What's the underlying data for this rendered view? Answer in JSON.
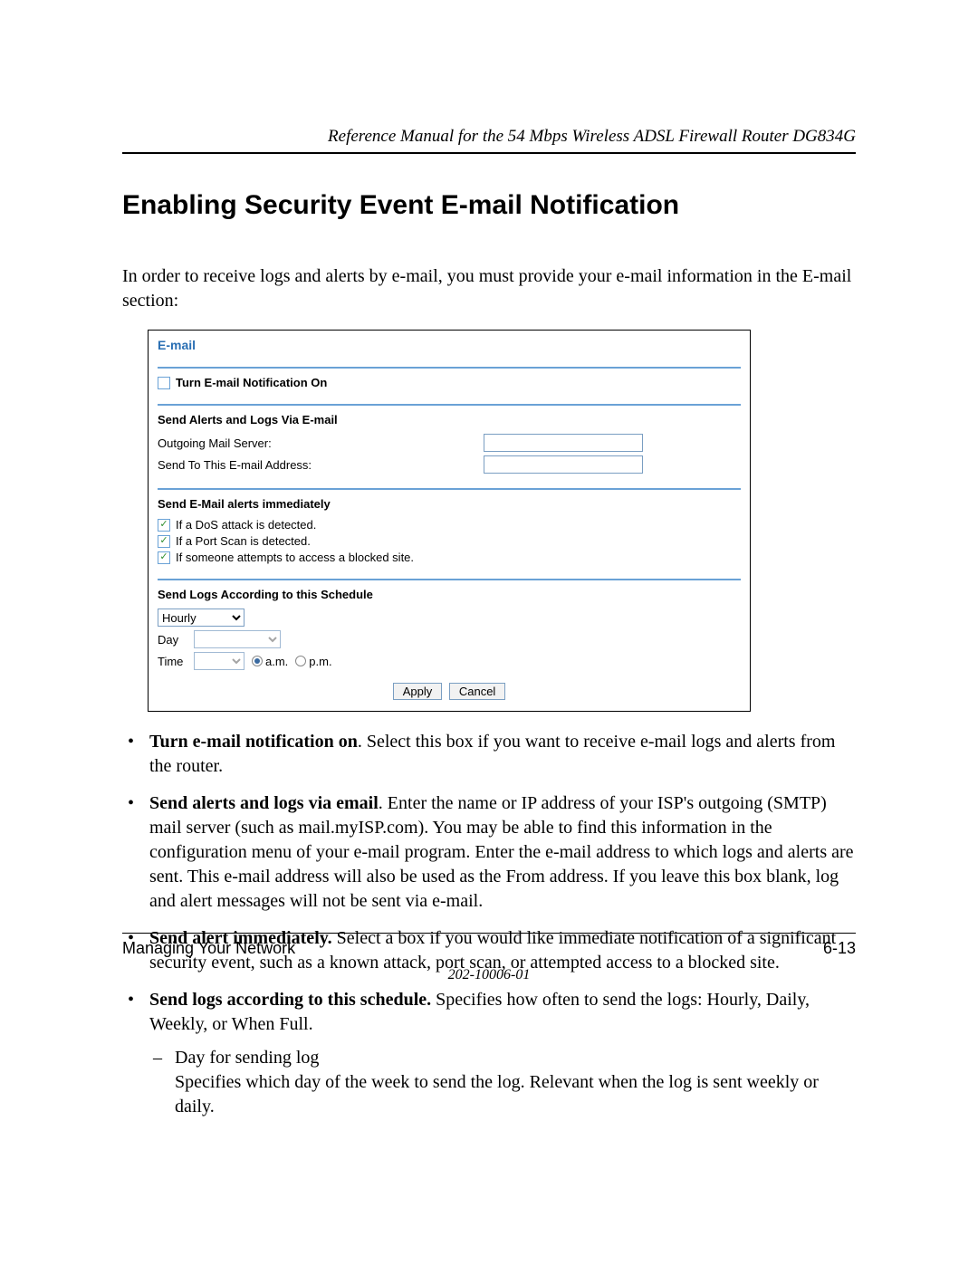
{
  "header": {
    "running_title": "Reference Manual for the 54 Mbps Wireless ADSL Firewall Router DG834G"
  },
  "section": {
    "title": "Enabling Security Event E-mail Notification",
    "intro": "In order to receive logs and alerts by e-mail, you must provide your e-mail information in the E-mail section:"
  },
  "ui": {
    "panel_title": "E-mail",
    "turn_on": {
      "checked": false,
      "label": "Turn E-mail Notification On"
    },
    "alerts_logs": {
      "heading": "Send Alerts and Logs Via E-mail",
      "smtp_label": "Outgoing Mail Server:",
      "smtp_value": "",
      "to_label": "Send To This E-mail Address:",
      "to_value": ""
    },
    "immediate": {
      "heading": "Send E-Mail alerts immediately",
      "items": [
        {
          "checked": true,
          "label": "If a DoS attack is detected."
        },
        {
          "checked": true,
          "label": "If a Port Scan is detected."
        },
        {
          "checked": true,
          "label": "If someone attempts to access a blocked site."
        }
      ]
    },
    "schedule": {
      "heading": "Send Logs According to this Schedule",
      "freq_value": "Hourly",
      "day_label": "Day",
      "day_value": "",
      "time_label": "Time",
      "time_value": "",
      "am_label": "a.m.",
      "pm_label": "p.m.",
      "ampm_selected": "am"
    },
    "buttons": {
      "apply": "Apply",
      "cancel": "Cancel"
    }
  },
  "bullets": [
    {
      "lead": "Turn e-mail notification on",
      "rest": ". Select this box if you want to receive e-mail logs and alerts from the router."
    },
    {
      "lead": "Send alerts and logs via email",
      "rest": ". Enter the name or IP address of your ISP's outgoing (SMTP) mail server (such as mail.myISP.com). You may be able to find this information in the configuration menu of your e-mail program. Enter the e-mail address to which logs and alerts are sent. This e-mail address will also be used as the From address. If you leave this box blank, log and alert messages will not be sent via e-mail."
    },
    {
      "lead": "Send alert immediately.",
      "rest": " Select a box if you would like immediate notification of a significant security event, such as a known attack, port scan, or attempted access to a blocked site."
    },
    {
      "lead": "Send logs according to this schedule.",
      "rest": " Specifies how often to send the logs: Hourly, Daily, Weekly, or When Full.",
      "sub": [
        {
          "line1": "Day for sending log",
          "line2": "Specifies which day of the week to send the log. Relevant when the log is sent weekly or daily."
        }
      ]
    }
  ],
  "footer": {
    "left": "Managing Your Network",
    "right": "6-13",
    "docnum": "202-10006-01"
  }
}
